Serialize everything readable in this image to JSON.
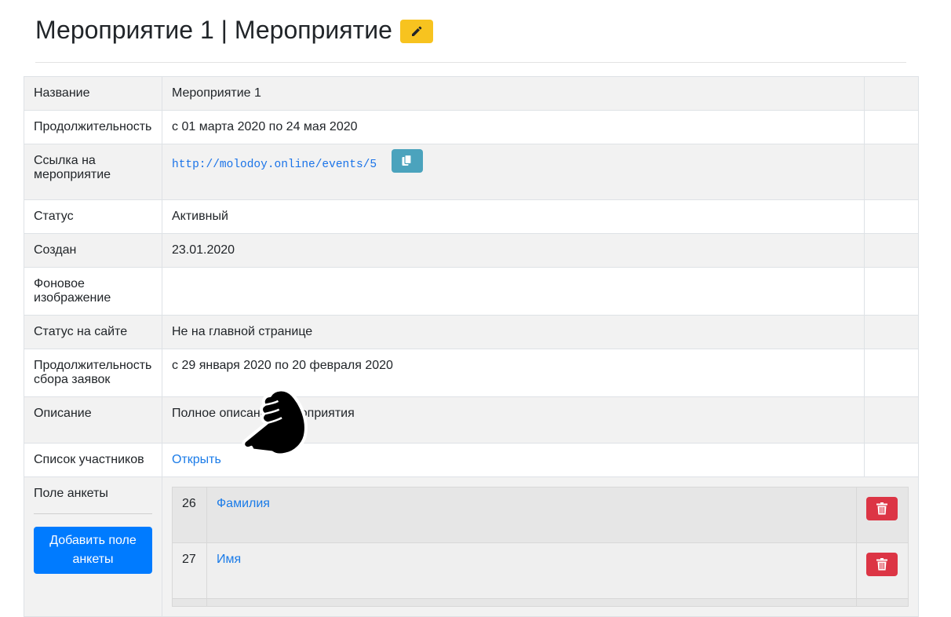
{
  "header": {
    "title": "Мероприятие 1 | Мероприятие",
    "edit_icon": "pencil-icon",
    "edit_color": "#f7c31f"
  },
  "details": {
    "name_label": "Название",
    "name_value": "Мероприятие 1",
    "duration_label": "Продолжительность",
    "duration_value": "с 01 марта 2020 по 24 мая 2020",
    "event_link_label": "Ссылка на мероприятие",
    "event_link_value": "http://molodoy.online/events/5",
    "copy_icon": "copy-icon",
    "status_label": "Статус",
    "status_value": "Активный",
    "created_label": "Создан",
    "created_value": "23.01.2020",
    "background_label": "Фоновое изображение",
    "background_value": "",
    "site_status_label": "Статус на сайте",
    "site_status_value": "Не на главной странице",
    "application_period_label": "Продолжительность сбора заявок",
    "application_period_value": "с 29 января 2020 по 20 февраля 2020",
    "description_label": "Описание",
    "description_value": "Полное описание мероприятия",
    "participants_label": "Список участников",
    "participants_link": "Открыть",
    "form_field_label": "Поле анкеты",
    "add_field_button": "Добавить поле анкеты"
  },
  "form_fields": [
    {
      "id": "26",
      "name": "Фамилия"
    },
    {
      "id": "27",
      "name": "Имя"
    }
  ],
  "colors": {
    "primary": "#007bff",
    "info": "#4ba3bd",
    "danger": "#dc3545",
    "warning": "#f7c31f",
    "link": "#1a7be8"
  },
  "cursor": "hand-pointer-icon"
}
